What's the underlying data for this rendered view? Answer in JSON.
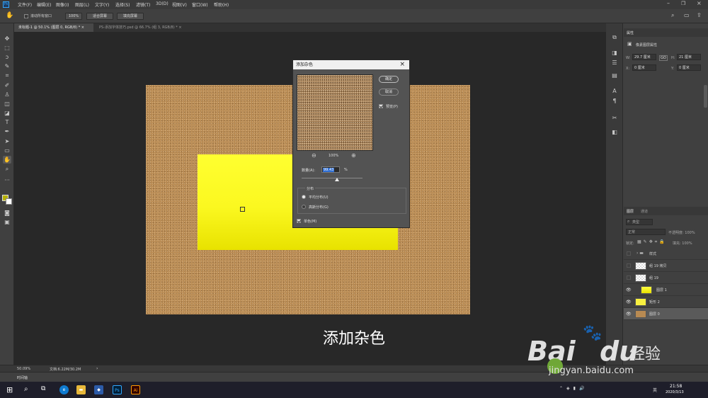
{
  "app": {
    "ps_logo": "Ps"
  },
  "menu": [
    "文件(F)",
    "编辑(E)",
    "图像(I)",
    "图层(L)",
    "文字(Y)",
    "选择(S)",
    "滤镜(T)",
    "3D(D)",
    "视图(V)",
    "窗口(W)",
    "帮助(H)"
  ],
  "options": {
    "scroll_all": "滚动所有窗口",
    "zoom": "100%",
    "fit_screen": "适合屏幕",
    "fill_screen": "填充屏幕"
  },
  "tabs": [
    {
      "label": "未标题-1 @ 50.1% (图层 0, RGB/8) * ×",
      "active": true
    },
    {
      "label": "PS-添加字体技巧.psd @ 66.7% (组 3, RGB/8) * ×",
      "active": false
    }
  ],
  "dialog": {
    "title": "添加杂色",
    "close": "×",
    "ok": "确定",
    "cancel": "取消",
    "preview_label": "预览(P)",
    "zoom": "100%",
    "amount_label": "数量(A):",
    "amount_value": "99.43",
    "amount_unit": "%",
    "distribution_title": "分布",
    "uniform": "平均分布(U)",
    "gaussian": "高斯分布(G)",
    "mono": "单色(M)"
  },
  "subtitle": "添加杂色",
  "properties": {
    "tab": "属性",
    "title": "像素图层属性",
    "w_label": "W:",
    "w_value": "29.7 厘米",
    "link": "GO",
    "h_label": "H:",
    "h_value": "21 厘米",
    "x_label": "X:",
    "x_value": "0 厘米",
    "y_label": "Y:",
    "y_value": "0 厘米"
  },
  "layers_panel": {
    "tabs": [
      "图层",
      "通道"
    ],
    "search": "类型",
    "blend": "正常",
    "opacity": "不透明度: 100%",
    "lock": "锁定:",
    "fill": "填充: 100%",
    "layers": [
      {
        "name": "样式",
        "visible": false,
        "kind": "folder"
      },
      {
        "name": "组 19 拷贝",
        "visible": false,
        "kind": "transparent"
      },
      {
        "name": "组 19",
        "visible": false,
        "kind": "transparent"
      },
      {
        "name": "图层 1",
        "visible": true,
        "kind": "yellow"
      },
      {
        "name": "矩形 2",
        "visible": true,
        "kind": "shape"
      },
      {
        "name": "图层 0",
        "visible": true,
        "kind": "noise",
        "selected": true
      }
    ]
  },
  "status": {
    "zoom": "50.09%",
    "doc": "文档:6.22M/30.2M"
  },
  "timeline": "时间轴",
  "taskbar": {
    "time": "21:58",
    "date": "2020/3/13",
    "ime": "英"
  },
  "watermark": {
    "brand": "Bai",
    "du": "du",
    "jingyan": "经验",
    "site": "jingyan.baidu.com"
  },
  "colors": {
    "yellow": "#ffff30",
    "noise_base": "#b88a52",
    "panel": "#404040"
  }
}
